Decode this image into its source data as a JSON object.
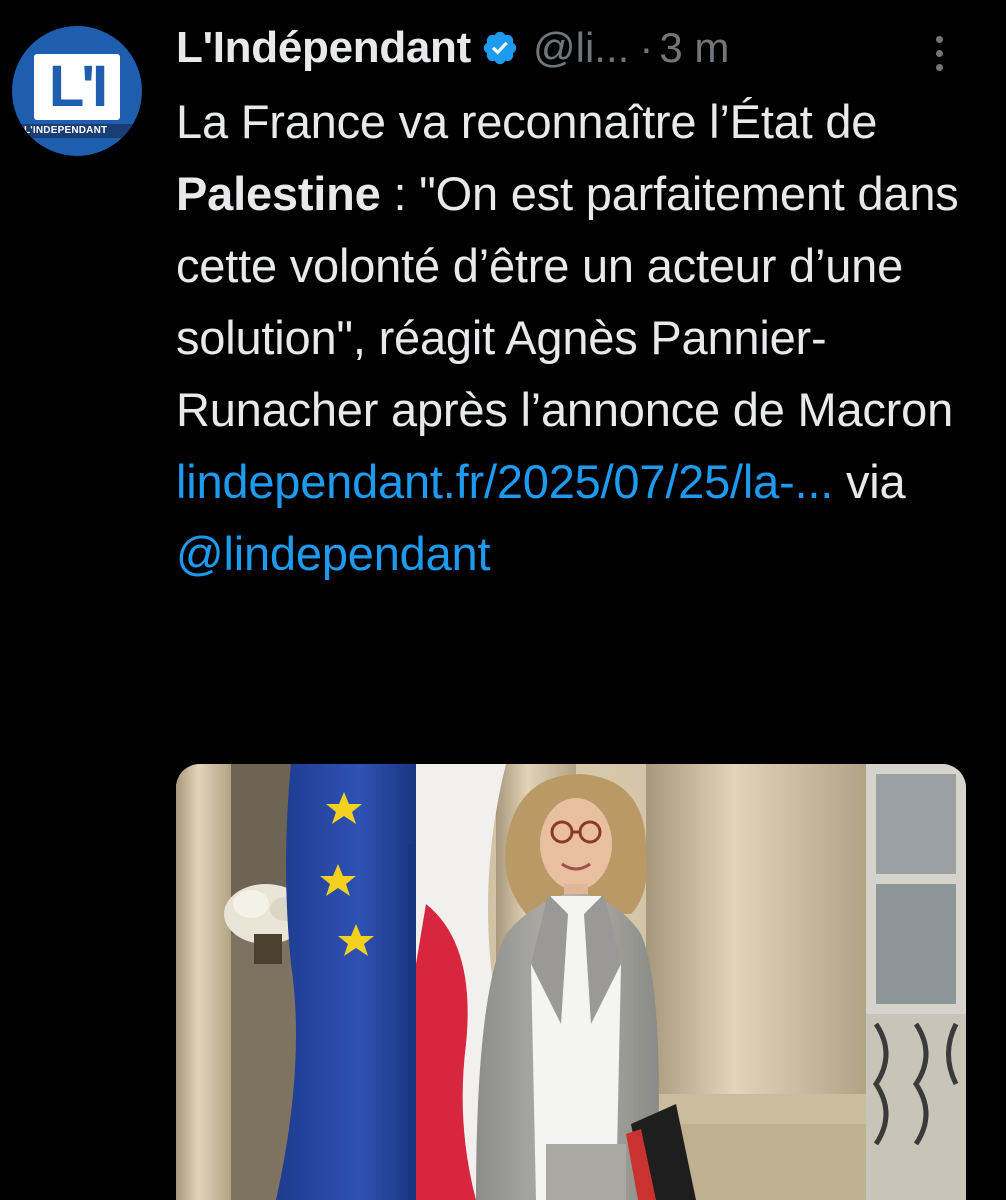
{
  "account": {
    "display_name": "L'Indépendant",
    "handle": "@li...",
    "separator": "·",
    "time": "3 m",
    "avatar_logo_text": "L'I",
    "avatar_caption": "L'INDEPENDANT"
  },
  "tweet": {
    "text_part1": "La France va reconnaître l’État de ",
    "text_bold": "Palestine",
    "text_part2": " : \"On est parfaitement dans cette volonté d’être un acteur d’une solution\", réagit Agnès Pannier-Runacher après l’annonce de Macron ",
    "link": "lindependant.fr/2025/07/25/la-...",
    "via_text": " via ",
    "mention": "@lindependant"
  },
  "icons": {
    "verified": "verified-badge-icon",
    "more": "more-options-icon"
  },
  "colors": {
    "background": "#000000",
    "text": "#e7e9ea",
    "secondary": "#71767b",
    "link": "#1d9bf0",
    "verified": "#1d9bf0",
    "avatar_blue": "#1d5fae"
  }
}
